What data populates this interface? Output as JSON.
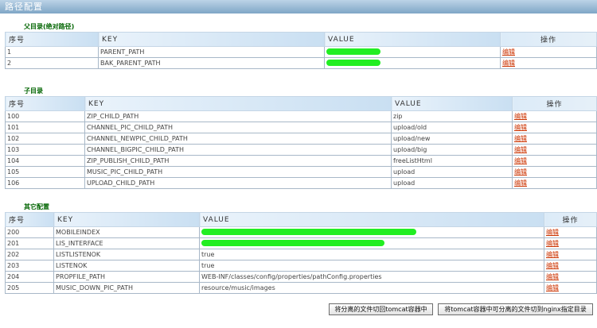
{
  "page_title": "路径配置",
  "headers": {
    "seq": "序号",
    "key": "KEY",
    "value": "VALUE",
    "op": "操作"
  },
  "edit_label": "编辑",
  "sections": [
    {
      "title": "父目录(绝对路径)",
      "rows": [
        {
          "seq": "1",
          "key": "PARENT_PATH",
          "value": "",
          "redacted": true
        },
        {
          "seq": "2",
          "key": "BAK_PARENT_PATH",
          "value": "",
          "redacted": true
        }
      ]
    },
    {
      "title": "子目录",
      "rows": [
        {
          "seq": "100",
          "key": "ZIP_CHILD_PATH",
          "value": "zip"
        },
        {
          "seq": "101",
          "key": "CHANNEL_PIC_CHILD_PATH",
          "value": "upload/old"
        },
        {
          "seq": "102",
          "key": "CHANNEL_NEWPIC_CHILD_PATH",
          "value": "upload/new"
        },
        {
          "seq": "103",
          "key": "CHANNEL_BIGPIC_CHILD_PATH",
          "value": "upload/big"
        },
        {
          "seq": "104",
          "key": "ZIP_PUBLISH_CHILD_PATH",
          "value": "freeListHtml"
        },
        {
          "seq": "105",
          "key": "MUSIC_PIC_CHILD_PATH",
          "value": "upload"
        },
        {
          "seq": "106",
          "key": "UPLOAD_CHILD_PATH",
          "value": "upload"
        }
      ]
    },
    {
      "title": "其它配置",
      "rows": [
        {
          "seq": "200",
          "key": "MOBILEINDEX",
          "value": "",
          "redacted": true
        },
        {
          "seq": "201",
          "key": "LIS_INTERFACE",
          "value": "",
          "redacted": true
        },
        {
          "seq": "202",
          "key": "LISTLISTENOK",
          "value": "true"
        },
        {
          "seq": "203",
          "key": "LISTENOK",
          "value": "true"
        },
        {
          "seq": "204",
          "key": "PROPFILE_PATH",
          "value": "WEB-INF/classes/config/properties/pathConfig.properties"
        },
        {
          "seq": "205",
          "key": "MUSIC_DOWN_PIC_PATH",
          "value": "resource/music/images"
        }
      ]
    }
  ],
  "buttons": {
    "move_back": "将分离的文件切回tomcat容器中",
    "move_to_nginx": "将tomcat容器中可分离的文件切到nginx指定目录"
  },
  "colors": {
    "section_title": "#006400",
    "edit_link": "#cc3300",
    "redaction": "#22ee22"
  }
}
